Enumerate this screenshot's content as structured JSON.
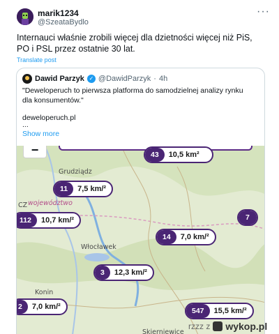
{
  "post": {
    "display_name": "marik1234",
    "handle": "@SzeataBydlo",
    "text": "Internauci właśnie zrobili więcej dla dzietności więcej niż PiS, PO i PSL przez ostatnie 30 lat.",
    "translate_label": "Translate post",
    "more_icon": "more-icon"
  },
  "quote": {
    "display_name": "Dawid Parzyk",
    "handle": "@DawidParzyk",
    "dot": "·",
    "time": "4h",
    "text": "\"Deweloperuch to pierwsza platforma do samodzielnej analizy rynku dla konsumentów.\"",
    "link": "deweloperuch.pl",
    "ellipsis": "...",
    "show_more": "Show more"
  },
  "map": {
    "zoom_out_label": "−",
    "places": {
      "grudziadz": "Grudziądz",
      "region": "województwo",
      "region_prefix": "CZ",
      "wloclawek": "Włocławek",
      "konin": "Konin",
      "skierniewice": "Skierniewice"
    },
    "pins": [
      {
        "count": "43",
        "density": "10,5 km²"
      },
      {
        "count": "11",
        "density": "7,5 km/²"
      },
      {
        "count": "112",
        "density": "10,7 km/²"
      },
      {
        "count": "7",
        "density": ""
      },
      {
        "count": "14",
        "density": "7,0 km/²"
      },
      {
        "count": "3",
        "density": "12,3 km/²"
      },
      {
        "count": "2",
        "density": "7,0 km/²"
      },
      {
        "count": "547",
        "density": "15,5 km/²"
      }
    ]
  },
  "watermark": {
    "prefix": "rzzz z",
    "site": "wykop.pl"
  },
  "colors": {
    "pin_accent": "#4a2574",
    "link": "#1d9bf0",
    "muted": "#536471"
  }
}
